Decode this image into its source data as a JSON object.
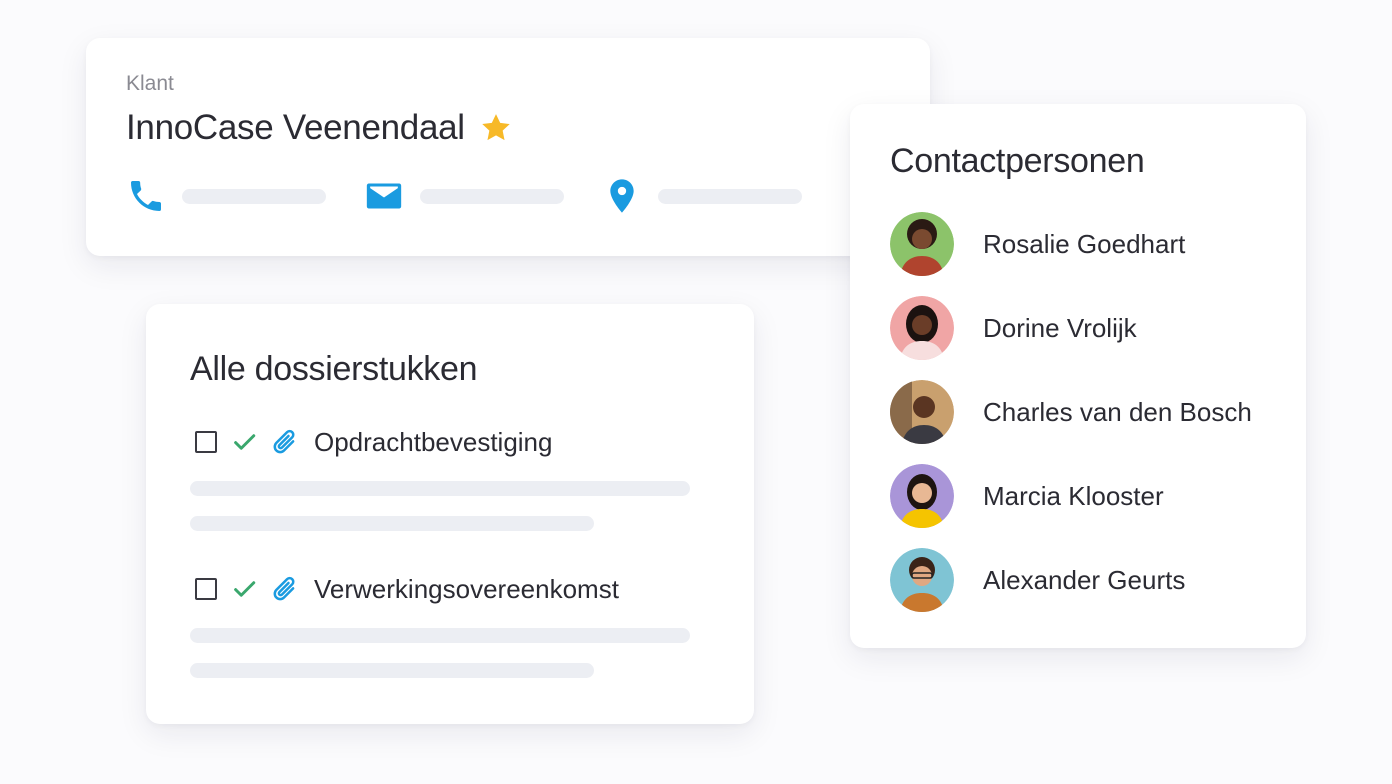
{
  "client": {
    "kicker": "Klant",
    "name": "InnoCase Veenendaal",
    "favorite": true,
    "contact_icons": [
      "phone-icon",
      "mail-icon",
      "location-pin-icon"
    ],
    "accent_color": "#1a9be0",
    "star_color": "#f7b928"
  },
  "documents": {
    "title": "Alle dossierstukken",
    "items": [
      {
        "label": "Opdrachtbevestiging",
        "checked": false,
        "status_icon": "check-icon",
        "attachment_icon": "paperclip-icon"
      },
      {
        "label": "Verwerkingsovereenkomst",
        "checked": false,
        "status_icon": "check-icon",
        "attachment_icon": "paperclip-icon"
      }
    ],
    "check_color": "#3aa76d"
  },
  "contacts": {
    "title": "Contactpersonen",
    "people": [
      {
        "name": "Rosalie Goedhart",
        "avatar_bg": "#8cc36a"
      },
      {
        "name": "Dorine Vrolijk",
        "avatar_bg": "#f0a5a5"
      },
      {
        "name": "Charles van den Bosch",
        "avatar_bg": "#c9a06e"
      },
      {
        "name": "Marcia Klooster",
        "avatar_bg": "#a995d8"
      },
      {
        "name": "Alexander Geurts",
        "avatar_bg": "#7fc4d4"
      }
    ]
  }
}
